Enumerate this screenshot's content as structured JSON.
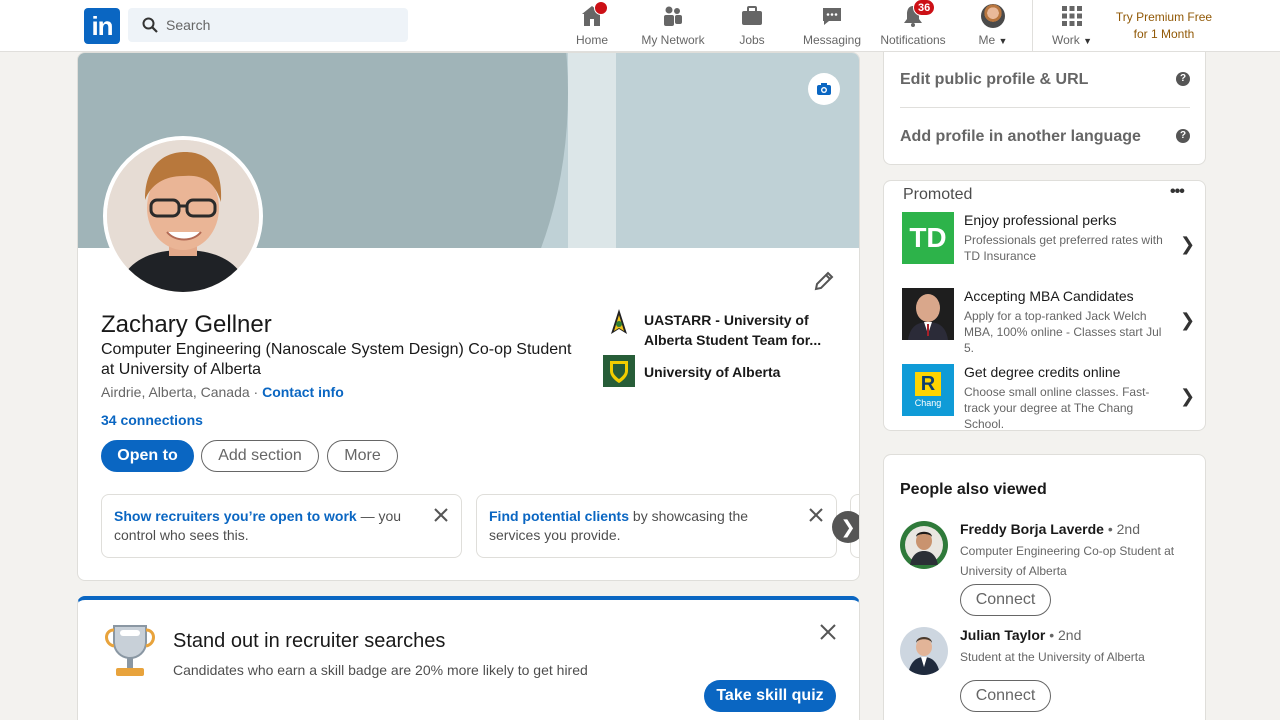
{
  "nav": {
    "logo": "in",
    "search_placeholder": "Search",
    "items": [
      {
        "label": "Home",
        "icon": "home-icon"
      },
      {
        "label": "My Network",
        "icon": "network-icon"
      },
      {
        "label": "Jobs",
        "icon": "briefcase-icon"
      },
      {
        "label": "Messaging",
        "icon": "messaging-icon"
      },
      {
        "label": "Notifications",
        "icon": "bell-icon",
        "badge": "36"
      },
      {
        "label": "Me",
        "icon": "avatar"
      },
      {
        "label": "Work",
        "icon": "grid-icon"
      }
    ],
    "premium_line1": "Try Premium Free",
    "premium_line2": "for 1 Month",
    "accent": "#0a66c2",
    "premium_color": "#915907"
  },
  "profile": {
    "name": "Zachary Gellner",
    "headline": "Computer Engineering (Nanoscale System Design) Co-op Student at University of Alberta",
    "location": "Airdrie, Alberta, Canada",
    "separator": " · ",
    "contact_info": "Contact info",
    "connections": "34 connections",
    "buttons": {
      "open_to": "Open to",
      "add_section": "Add section",
      "more": "More"
    },
    "experience": [
      {
        "name": "UASTARR - University of Alberta Student Team for...",
        "icon": "uastarr-logo"
      },
      {
        "name": "University of Alberta",
        "icon": "ualberta-logo"
      }
    ],
    "tips": [
      {
        "link": "Show recruiters you’re open to work",
        "rest": " — you control who sees this."
      },
      {
        "link": "Find potential clients",
        "rest": " by showcasing the services you provide."
      }
    ]
  },
  "skill": {
    "title": "Stand out in recruiter searches",
    "subtitle": "Candidates who earn a skill badge are 20% more likely to get hired",
    "button": "Take skill quiz"
  },
  "rail": {
    "edit_profile": "Edit public profile & URL",
    "add_language": "Add profile in another language",
    "help": "?",
    "promoted": "Promoted",
    "more": "•••",
    "ads": [
      {
        "title": "Enjoy professional perks",
        "desc": "Professionals get preferred rates with TD Insurance",
        "logo": "TD"
      },
      {
        "title": "Accepting MBA Candidates",
        "desc": "Apply for a top-ranked Jack Welch MBA, 100% online - Classes start Jul 5.",
        "logo": ""
      },
      {
        "title": "Get degree credits online",
        "desc": "Choose small online classes. Fast-track your degree at The Chang School.",
        "logo": "R",
        "logo_sub": "Chang"
      }
    ],
    "people_title": "People also viewed",
    "people": [
      {
        "name": "Freddy Borja Laverde",
        "degree": " • 2nd",
        "desc": "Computer Engineering Co-op Student at University of Alberta",
        "button": "Connect"
      },
      {
        "name": "Julian Taylor",
        "degree": " • 2nd",
        "desc": "Student at the University of Alberta",
        "button": "Connect"
      }
    ]
  }
}
